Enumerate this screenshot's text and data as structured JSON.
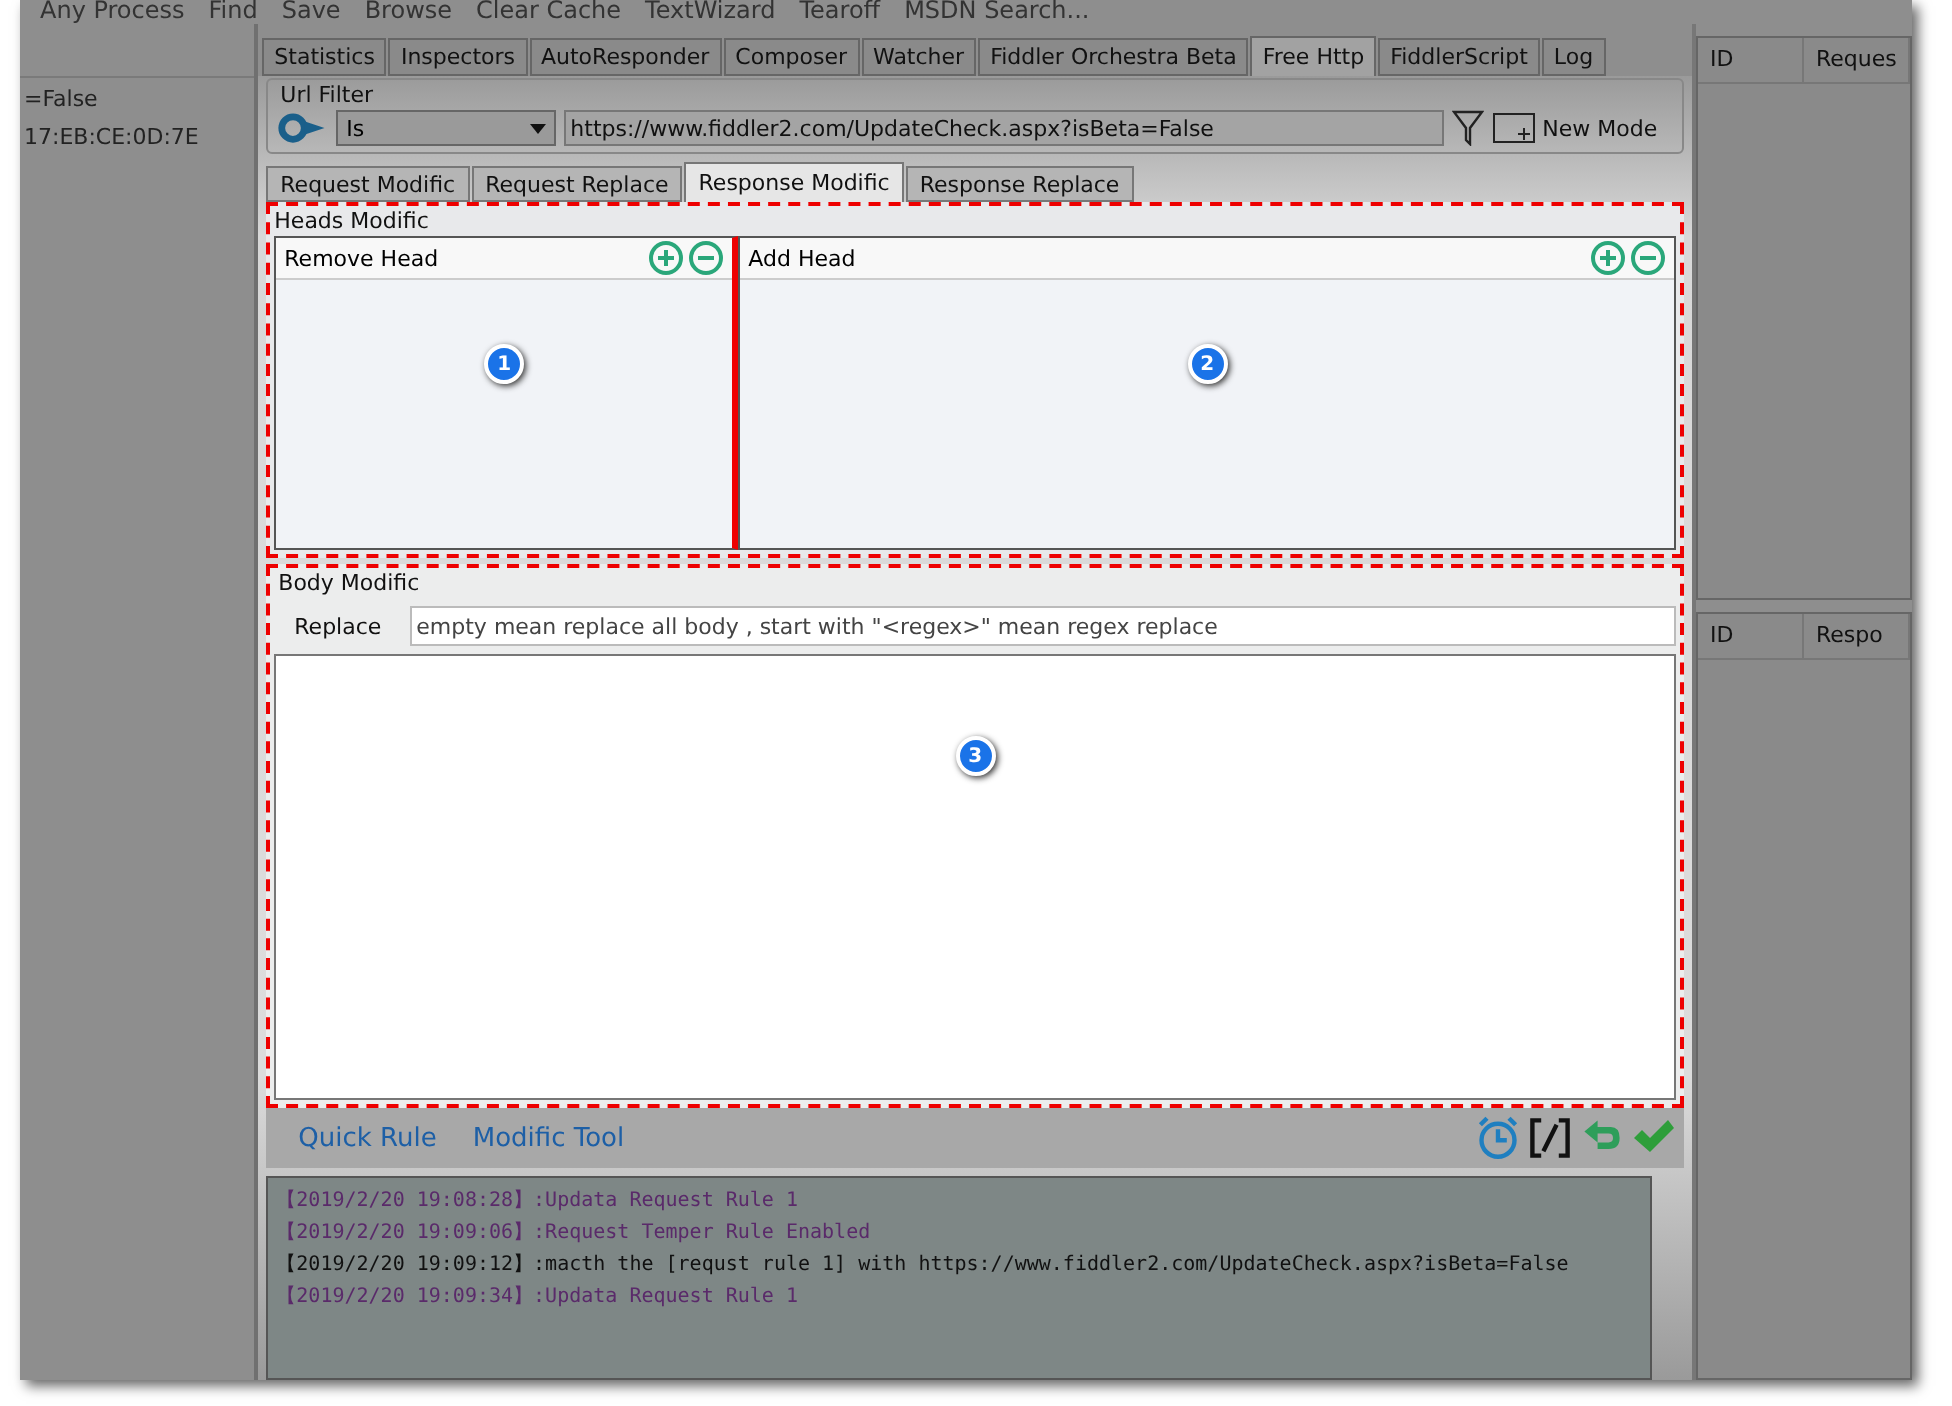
{
  "toolbar": [
    "Any Process",
    "Find",
    "Save",
    "Browse",
    "Clear Cache",
    "TextWizard",
    "Tearoff",
    "MSDN Search..."
  ],
  "left_panel": {
    "lines": [
      "=False",
      "17:EB:CE:0D:7E"
    ]
  },
  "tabs": [
    {
      "label": "Statistics",
      "selected": false
    },
    {
      "label": "Inspectors",
      "selected": false
    },
    {
      "label": "AutoResponder",
      "selected": false
    },
    {
      "label": "Composer",
      "selected": false
    },
    {
      "label": "Watcher",
      "selected": false
    },
    {
      "label": "Fiddler Orchestra Beta",
      "selected": false
    },
    {
      "label": "Free Http",
      "selected": true
    },
    {
      "label": "FiddlerScript",
      "selected": false
    },
    {
      "label": "Log",
      "selected": false
    }
  ],
  "url_filter": {
    "title": "Url Filter",
    "match": "Is",
    "url": "https://www.fiddler2.com/UpdateCheck.aspx?isBeta=False",
    "new_mode": "New Mode"
  },
  "sub_tabs": [
    {
      "label": "Request Modific",
      "selected": false
    },
    {
      "label": "Request Replace",
      "selected": false
    },
    {
      "label": "Response Modific",
      "selected": true
    },
    {
      "label": "Response Replace",
      "selected": false
    }
  ],
  "heads": {
    "title": "Heads Modific",
    "lists": [
      {
        "title": "Remove Head",
        "marker": "1"
      },
      {
        "title": "Add Head",
        "marker": "2"
      }
    ]
  },
  "body": {
    "title": "Body Modific",
    "label": "Replace",
    "placeholder": "empty mean replace all body , start with \"<regex>\" mean regex replace",
    "marker": "3"
  },
  "links": [
    "Quick Rule",
    "Modific Tool"
  ],
  "log": [
    {
      "time": "【2019/2/20 19:08:28】",
      "text": ":Updata Request Rule 1",
      "color": "#5a2a6a"
    },
    {
      "time": "【2019/2/20 19:09:06】",
      "text": ":Request Temper Rule Enabled",
      "color": "#5a2a6a"
    },
    {
      "time": "【2019/2/20 19:09:12】",
      "text": ":macth the [requst rule 1] with https://www.fiddler2.com/UpdateCheck.aspx?isBeta=False",
      "color": "#111111"
    },
    {
      "time": "【2019/2/20 19:09:34】",
      "text": ":Updata Request Rule 1",
      "color": "#5a2a6a"
    }
  ],
  "right_panel": {
    "tables": [
      {
        "columns": [
          "ID",
          "Reques"
        ]
      },
      {
        "columns": [
          "ID",
          "Respo"
        ]
      }
    ]
  }
}
